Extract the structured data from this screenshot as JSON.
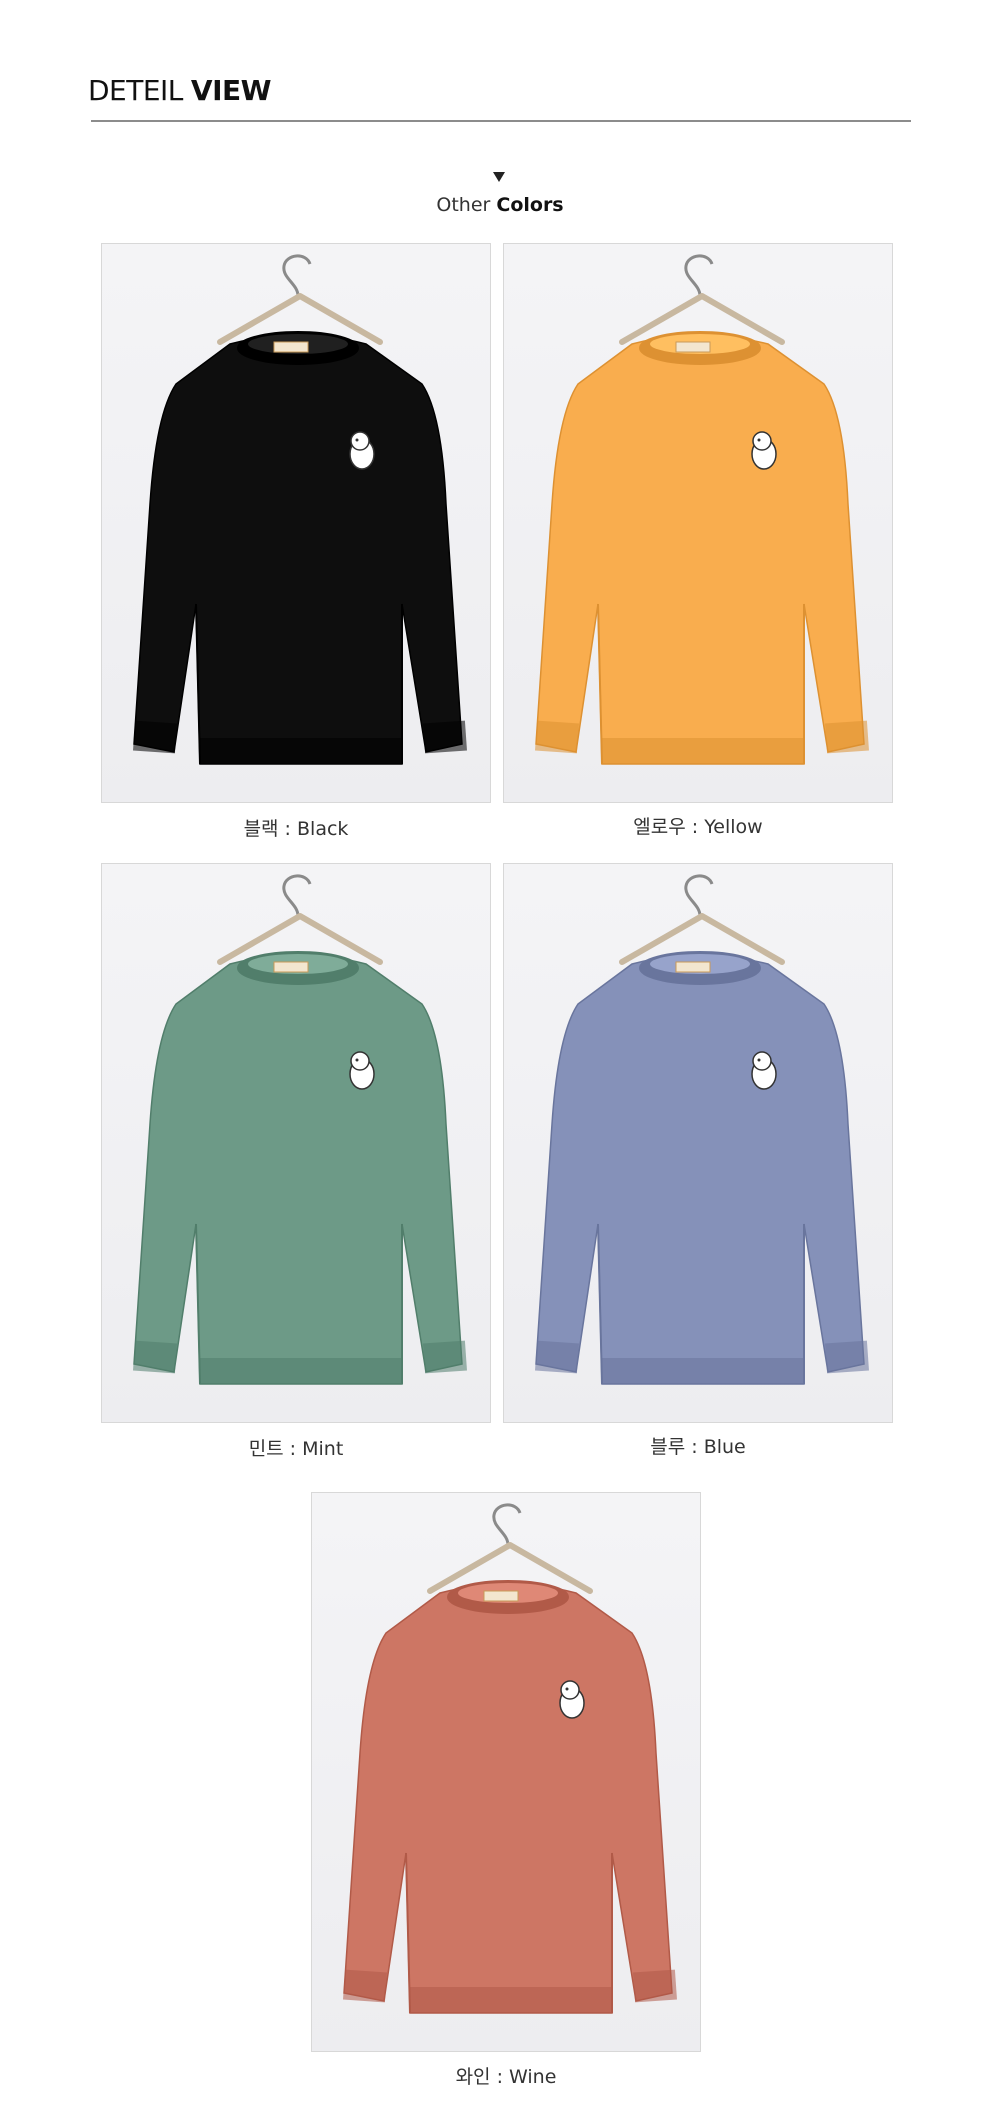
{
  "header": {
    "title_light": "DETEIL",
    "title_bold": "VIEW"
  },
  "section": {
    "subtitle_light": "Other",
    "subtitle_bold": "Colors"
  },
  "colors": [
    {
      "label": "블랙 : Black",
      "hex": "#0e0e0e"
    },
    {
      "label": "엘로우 : Yellow",
      "hex": "#f9ad4e"
    },
    {
      "label": "민트 : Mint",
      "hex": "#6d9a87"
    },
    {
      "label": "블루 : Blue",
      "hex": "#8591b9"
    },
    {
      "label": "와인 : Wine",
      "hex": "#cd7664"
    }
  ]
}
